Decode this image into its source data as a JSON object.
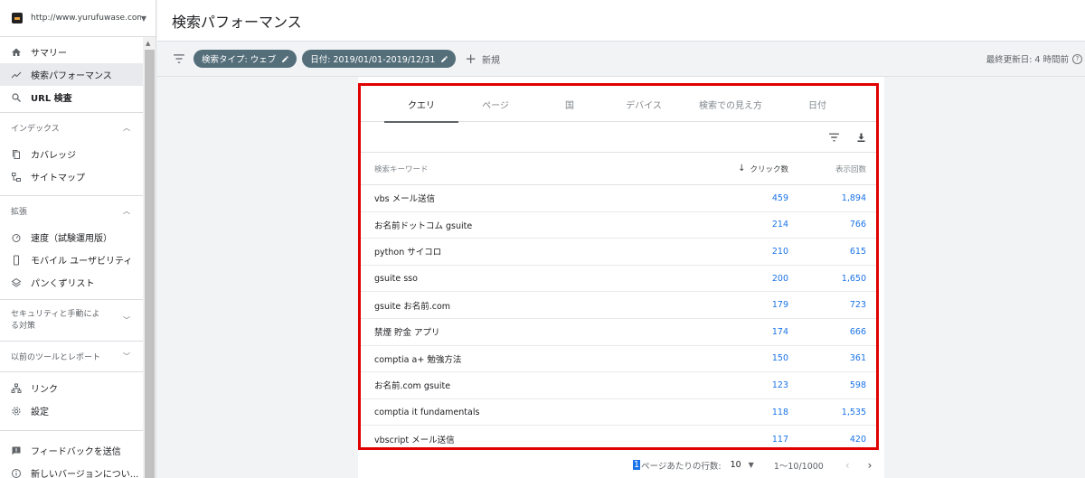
{
  "property": {
    "url": "http://www.yurufuwase.com/"
  },
  "header": {
    "title": "検索パフォーマンス"
  },
  "sidebar": {
    "top_items": [
      {
        "label": "サマリー",
        "icon": "home-icon"
      },
      {
        "label": "検索パフォーマンス",
        "icon": "trending-up-icon",
        "active": true
      },
      {
        "label": "URL 検査",
        "icon": "search-icon"
      }
    ],
    "index_section": {
      "label": "インデックス",
      "items": [
        {
          "label": "カバレッジ",
          "icon": "copy-icon"
        },
        {
          "label": "サイトマップ",
          "icon": "sitemap-icon"
        }
      ]
    },
    "enhance_section": {
      "label": "拡張",
      "items": [
        {
          "label": "速度（試験運用版）",
          "icon": "speed-icon"
        },
        {
          "label": "モバイル ユーザビリティ",
          "icon": "phone-icon"
        },
        {
          "label": "パンくずリスト",
          "icon": "layers-icon"
        }
      ]
    },
    "security_section": {
      "label": "セキュリティと手動によ る対策"
    },
    "legacy_section": {
      "label": "以前のツールとレポート"
    },
    "bottom_items": [
      {
        "label": "リンク",
        "icon": "links-icon"
      },
      {
        "label": "設定",
        "icon": "gear-icon"
      }
    ],
    "footer_items": [
      {
        "label": "フィードバックを送信",
        "icon": "feedback-icon"
      },
      {
        "label": "新しいバージョンについ...",
        "icon": "info-icon"
      }
    ]
  },
  "filters": {
    "chips": [
      {
        "label": "検索タイプ: ウェブ"
      },
      {
        "label": "日付: 2019/01/01-2019/12/31"
      }
    ],
    "new_label": "新規",
    "last_updated": "最終更新日: 4 時間前"
  },
  "tabs": [
    {
      "label": "クエリ",
      "active": true
    },
    {
      "label": "ページ"
    },
    {
      "label": "国"
    },
    {
      "label": "デバイス"
    },
    {
      "label": "検索での見え方"
    },
    {
      "label": "日付"
    }
  ],
  "table": {
    "columns": {
      "keyword": "検索キーワード",
      "clicks": "クリック数",
      "impressions": "表示回数"
    },
    "rows": [
      {
        "keyword": "vbs メール送信",
        "clicks": "459",
        "impressions": "1,894"
      },
      {
        "keyword": "お名前ドットコム gsuite",
        "clicks": "214",
        "impressions": "766"
      },
      {
        "keyword": "python サイコロ",
        "clicks": "210",
        "impressions": "615"
      },
      {
        "keyword": "gsuite sso",
        "clicks": "200",
        "impressions": "1,650"
      },
      {
        "keyword": "gsuite お名前.com",
        "clicks": "179",
        "impressions": "723"
      },
      {
        "keyword": "禁煙 貯金 アプリ",
        "clicks": "174",
        "impressions": "666"
      },
      {
        "keyword": "comptia a+ 勉強方法",
        "clicks": "150",
        "impressions": "361"
      },
      {
        "keyword": "お名前.com gsuite",
        "clicks": "123",
        "impressions": "598"
      },
      {
        "keyword": "comptia it fundamentals",
        "clicks": "118",
        "impressions": "1,535"
      },
      {
        "keyword": "vbscript メール送信",
        "clicks": "117",
        "impressions": "420"
      }
    ]
  },
  "pager": {
    "highlight": "1",
    "rows_label": "ページあたりの行数:",
    "rows_value": "10",
    "range": "1～10/1000"
  },
  "colors": {
    "accent": "#1a73e8",
    "chip": "#546e7a",
    "highlight_border": "#e00000"
  }
}
